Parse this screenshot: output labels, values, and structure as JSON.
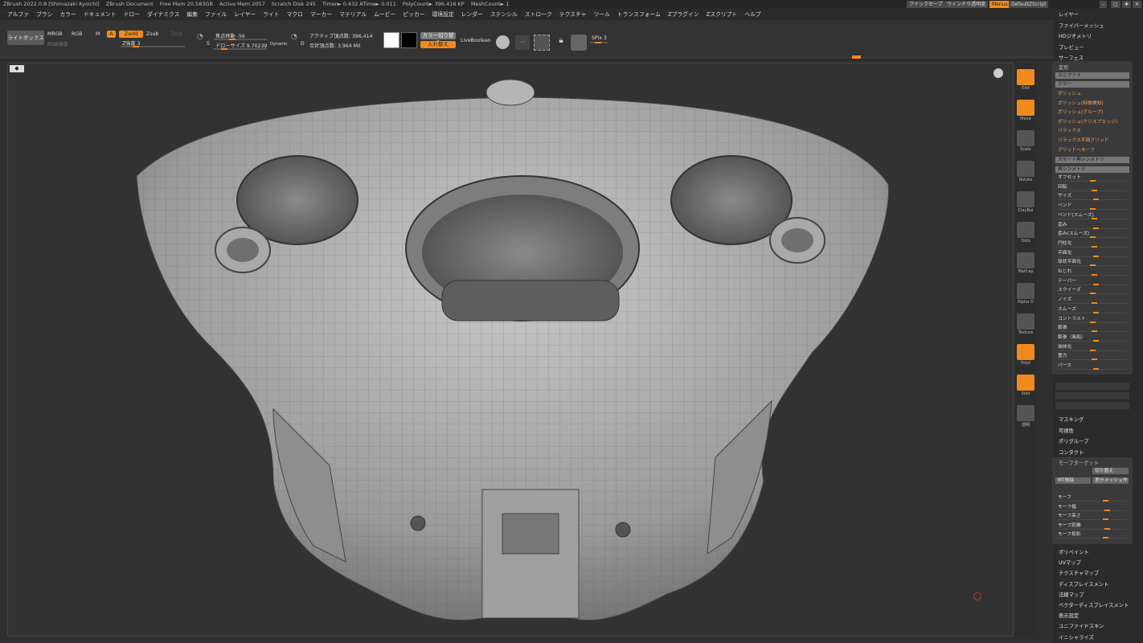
{
  "titlebar": {
    "app": "ZBrush 2022.0.8 [Shimazaki Kyoichi]",
    "doc": "ZBrush Document",
    "free_mem": "Free Mem 20.583GB",
    "active_mem": "Active Mem 2057",
    "scratch": "Scratch Disk 245",
    "timer": "Timer► 0.432 ATime► 0.011",
    "poly": "PolyCount► 396.416 KP",
    "mesh": "MeshCount► 1",
    "quicksave": "クイックセーブ",
    "transparency": "ウィンドウ透明度",
    "menus": "Menus",
    "script": "DefaultZScript"
  },
  "menu": [
    "アルファ",
    "ブラシ",
    "カラー",
    "ドキュメント",
    "ドロー",
    "ダイナミクス",
    "編集",
    "ファイル",
    "レイヤー",
    "ライト",
    "マクロ",
    "マーカー",
    "マテリアル",
    "ムービー",
    "ピッカー",
    "環境設定",
    "レンダー",
    "ステンシル",
    "ストローク",
    "テクスチャ",
    "ツール",
    "トランスフォーム",
    "Zプラグイン",
    "Zスクリプト",
    "ヘルプ"
  ],
  "toolbar": {
    "lightbox": "ライトボックス",
    "mrgb": "MRGB",
    "rgb": "RGB",
    "m": "M",
    "zadd": "Zadd",
    "zsub": "Zsub",
    "zcut": "Zcut",
    "a": "A",
    "rgb_intensity": "RGB強度",
    "z_intensity": "Z強度 3",
    "focal_shift": "焦点移動 -56",
    "draw_size": "ドローサイズ 9.70239",
    "dynamic": "Dynamic",
    "active_points": "アクティブ頂点数: 396,414",
    "total_points": "合計頂点数: 3.964 Mil",
    "color_switch": "カラー切り替え",
    "swap": "入れ替え",
    "live_boolean": "LiveBoolean",
    "spix": "SPix 3",
    "s_label": "S",
    "d_label": "D"
  },
  "shelf": [
    "Edit",
    "Move",
    "Scale",
    "Rotate",
    "ClayBui",
    "Dots",
    "MatCap",
    "Alpha O",
    "Texture",
    "Polyf",
    "Solo",
    "透明"
  ],
  "panel": {
    "top": [
      "レイヤー",
      "ファイバーメッシュ",
      "HDジオメトリ",
      "プレビュー",
      "サーフェス"
    ],
    "deform_title": "変形",
    "unify": "ユニファイ",
    "mirror": "ミラー",
    "polish_items": [
      "ポリッシュ",
      "ポリッシュ(特徴検知)",
      "ポリッシュ(グループ)",
      "ポリッシュ(クリスプエッジ)",
      "リラックス",
      "リラックス平面グリッド",
      "グリッドへモーフ"
    ],
    "smart_resym": "スマート再シンメトリ",
    "resym": "再シンメトリ",
    "sliders": [
      "オフセット",
      "回転",
      "サイズ",
      "ベンド",
      "ベンド(スムーズ)",
      "歪み",
      "歪み(スムーズ)",
      "円柱化",
      "平面化",
      "球状平面化",
      "ねじれ",
      "テーパー",
      "スクイーズ",
      "ノイズ",
      "スムーズ",
      "コントラスト",
      "膨張",
      "膨張（風船）",
      "球体化",
      "重力",
      "パース"
    ],
    "bottom": [
      "マスキング",
      "可視性",
      "ポリグループ",
      "コンタクト"
    ],
    "morph_title": "モーフターゲット",
    "switch": "切り替え",
    "mt_delete": "MT削除",
    "diff_mesh": "差分メッシュ作",
    "morph_sliders": [
      "モーフ",
      "モーフ幅",
      "モーフ高さ",
      "モーフ距離",
      "モーフ投影"
    ],
    "bottom2": [
      "ポリペイント",
      "UVマップ",
      "テクスチャマップ",
      "ディスプレイスメント",
      "法線マップ",
      "ベクターディスプレイスメント",
      "表示設定",
      "ユニファイドスキン",
      "イニシャライズ"
    ]
  },
  "accent": "#f08a1c"
}
